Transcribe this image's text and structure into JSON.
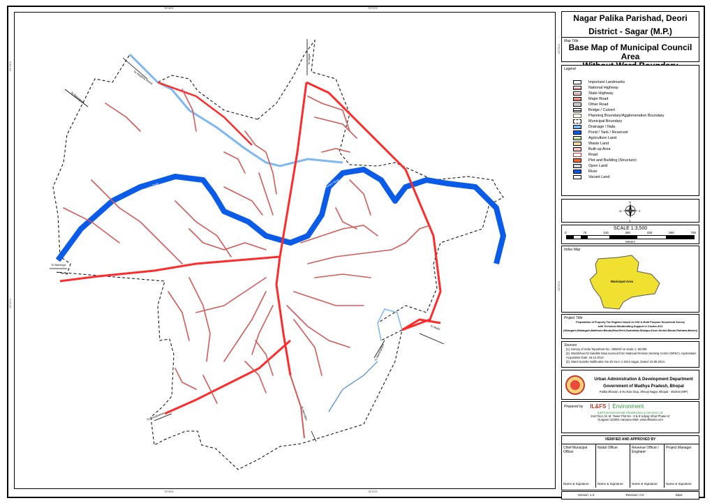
{
  "header": {
    "org": "Nagar Palika Parishad, Deori",
    "district": "District - Sagar (M.P.)"
  },
  "map_title": {
    "caption": "Map Title",
    "line1": "Base Map of Municipal Council Area",
    "line2": "Without Ward Boundary"
  },
  "coords": {
    "top_left": "78°34'E",
    "top_right": "78°37'E",
    "bottom_left": "78°34'E",
    "bottom_right": "78°37'E",
    "left_top": "23°24'N",
    "left_bottom": "23°22'N",
    "right_top": "23°24'N",
    "right_bottom": "23°22'N"
  },
  "legend": {
    "title": "Legend",
    "items": [
      {
        "label": "Important Landmarks",
        "fill": "#ffffff",
        "stroke": "#000000"
      },
      {
        "label": "National Highway",
        "fill": "#ffffff",
        "line": "#e41a1c"
      },
      {
        "label": "State Highway",
        "fill": "#ffffff",
        "line": "#ff4d4d"
      },
      {
        "label": "Major Road",
        "fill": "#f4a3a3",
        "line": "#d45a5a"
      },
      {
        "label": "Other Road",
        "fill": "#ffffff",
        "line": "#777777"
      },
      {
        "label": "Bridge / Culvert",
        "fill": "#ffffff",
        "line": "#000000"
      },
      {
        "label": "Planning Boundary/Agglomeration Boundary",
        "fill": "#ffffff",
        "stroke": "#6b5a2a"
      },
      {
        "label": "Municipal Boundary",
        "fill": "#ffffff",
        "dashed": true
      },
      {
        "label": "Drainage / Nala",
        "fill": "#7db8f0"
      },
      {
        "label": "Pond / Tank / Reservoir",
        "fill": "#0a5be8"
      },
      {
        "label": "Agriculture Land",
        "fill": "#e6f5d0",
        "line": "#7bc043"
      },
      {
        "label": "Waste Land",
        "fill": "#f8d9a0"
      },
      {
        "label": "Built-up Area",
        "fill": "#f7c6c6"
      },
      {
        "label": "Road",
        "fill": "#ffffff",
        "stroke": "#d62728"
      },
      {
        "label": "Plot and Building (Structure)",
        "fill": "#f26b2a"
      },
      {
        "label": "Open Land",
        "fill": "#cfd6dc"
      },
      {
        "label": "River",
        "fill": "#0a5be8"
      },
      {
        "label": "Vacant Land",
        "fill": "#ffffff",
        "stroke": "#000000"
      }
    ]
  },
  "north_arrow": {
    "n": "N",
    "s": "S",
    "e": "E",
    "w": "W"
  },
  "scale": {
    "title": "SCALE 1:3,500",
    "ticks": [
      "0",
      "70",
      "140",
      "280",
      "420",
      "560",
      "700"
    ],
    "unit": "Meters"
  },
  "index_map": {
    "title": "Index Map",
    "label": "Municipal Area",
    "fill": "#f0e130"
  },
  "project": {
    "caption": "Project Title",
    "line1": "Preparation of Property Tax Register based on GIS & Multi Purpose Household Survey",
    "line2": "with Technical Handholding Support in Cluster-9/11",
    "line3": "(Shahgarh,Rahatgarh,Malthone,Banda,Bina,Rehli,Garhakota,Shahpur,Deori,Surkhi,Bandri,Patharia,Bahrol)"
  },
  "sources": {
    "caption": "Sources",
    "items": [
      "[1]. Survey of India Toposheet No.: 55M/03 on Scale 1: 50,000",
      "[2]. WorldView-02 Satellite Data sourced from National Remote Sensing Centre (NRSC), Hyderabad. Acquisition Date: 16.12.2013",
      "[3]. Ward Gazette Notification No 25-Va Ic-1-2014 Sagar, Dated: 23.05.2014."
    ]
  },
  "department": {
    "line1": "Urban Administration & Development Department",
    "line2": "Government of Madhya Pradesh, Bhopal",
    "address": "Palika Bhavan, 6 No Bus Stop, Shivaji Nagar, Bhopal - 462016 (MP)"
  },
  "prepared": {
    "caption": "Prepared by",
    "brand": "IL&FS",
    "division": "Environment",
    "company": "IL&FS Environmental Infrastructure & Services Ltd.",
    "address1": "2nd Floor, M. M. Tower Plot No - 8 & 9 Udyog Vihar Phase-IV",
    "address2": "Gurgaon-122001 Haryana Web: www.ilfsindia.com",
    "brand_color": "#2e9b3a"
  },
  "approval": {
    "title": "VERIFIED AND APPROVED BY",
    "columns": [
      {
        "role": "Chief Municipal Officer",
        "sig": "Name & Signature"
      },
      {
        "role": "Nodal Officer",
        "sig": "Name & Signature"
      },
      {
        "role": "Revenue Officer / Engineer",
        "sig": "Name & Signature"
      },
      {
        "role": "Project Manager",
        "sig": "Name & Signature"
      }
    ]
  },
  "footer": {
    "version": "Version: 1.0",
    "revision": "Revision: 0.0",
    "date": "Date:"
  },
  "map_labels": {
    "to_sagar": "To Sagar",
    "to_hindoria": "To Hindoria Khurd",
    "to_rahatgarh": "To Rahatgarh",
    "to_baheriya": "To Baheriya",
    "to_barodiya": "To Barodiya",
    "to_narsinghpur": "To Narsinghpur",
    "to_rehli": "To Rehli",
    "to_gourjhamar": "To Gourjhamar",
    "river": "Sukhchain River"
  },
  "colors": {
    "river": "#0a5be8",
    "drainage": "#7db8f0",
    "highway": "#ff2a2a",
    "road": "#d45a5a"
  }
}
